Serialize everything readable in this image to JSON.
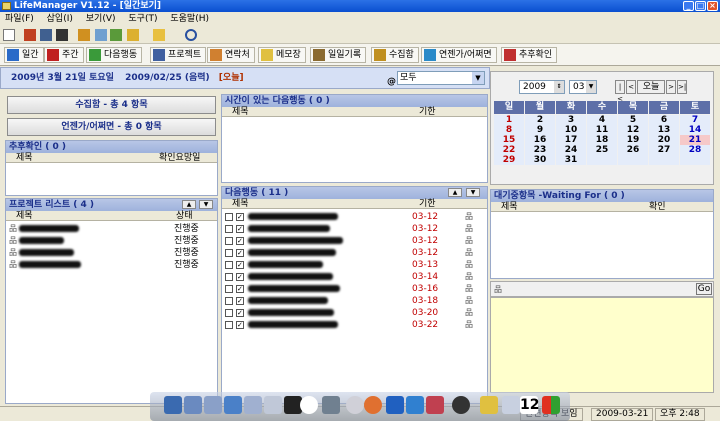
{
  "window": {
    "title": "LifeManager V1.12 - [일간보기]"
  },
  "menu": [
    "파일(F)",
    "삽입(I)",
    "보기(V)",
    "도구(T)",
    "도움말(H)"
  ],
  "views": [
    "일간",
    "주간",
    "다음행동",
    "프로젝트",
    "연락처",
    "메모장",
    "일일기록",
    "수집함",
    "연젠가/어쩌면",
    "추후확인"
  ],
  "date_bar": {
    "date": "2009년 3월 21일 토요일",
    "lunar": "2009/02/25 (음력)",
    "today": "[오늘]",
    "at": "@",
    "filter": "모두"
  },
  "inbox_btn": "수집함 - 총 4 항목",
  "someday_btn": "언젠가/어쩌면 - 총 0 항목",
  "followup": {
    "title": "추후확인 ( 0 )",
    "col_title": "제목",
    "col_need": "확인요망일"
  },
  "projects": {
    "title": "프로젝트 리스트 ( 4 )",
    "col_title": "제목",
    "col_status": "상태",
    "rows": [
      "진행중",
      "진행중",
      "진행중",
      "진행중"
    ]
  },
  "timed": {
    "title": "시간이 있는 다음행동 ( 0 )",
    "col_title": "제목",
    "col_due": "기한"
  },
  "next": {
    "title": "다음행동 ( 11 )",
    "col_title": "제목",
    "col_due": "기한",
    "rows": [
      "03-12",
      "03-12",
      "03-12",
      "03-12",
      "03-13",
      "03-14",
      "03-16",
      "03-18",
      "03-20",
      "03-22",
      ""
    ]
  },
  "calendar": {
    "year": "2009",
    "month": "03",
    "today_btn": "오늘",
    "headers": [
      "일",
      "월",
      "화",
      "수",
      "목",
      "금",
      "토"
    ],
    "weeks": [
      [
        "1",
        "2",
        "3",
        "4",
        "5",
        "6",
        "7"
      ],
      [
        "8",
        "9",
        "10",
        "11",
        "12",
        "13",
        "14"
      ],
      [
        "15",
        "16",
        "17",
        "18",
        "19",
        "20",
        "21"
      ],
      [
        "22",
        "23",
        "24",
        "25",
        "26",
        "27",
        "28"
      ],
      [
        "29",
        "30",
        "31",
        "",
        "",
        "",
        ""
      ]
    ]
  },
  "waiting": {
    "title": "대기중항목 -Waiting For ( 0 )",
    "col_title": "제목",
    "col_check": "확인"
  },
  "go_btn": "Go",
  "status": {
    "left": "관련항목 보임",
    "date": "2009-03-21",
    "time": "오후 2:48"
  },
  "dock_badge": "12"
}
